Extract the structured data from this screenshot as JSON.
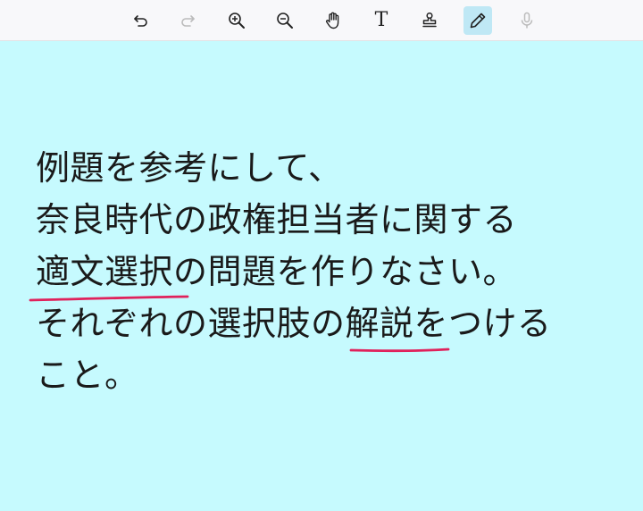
{
  "toolbar": {
    "tools": [
      {
        "name": "undo",
        "icon": "undo-icon",
        "active": false,
        "disabled": false
      },
      {
        "name": "redo",
        "icon": "redo-icon",
        "active": false,
        "disabled": true
      },
      {
        "name": "zoom-in",
        "icon": "zoom-in-icon",
        "active": false,
        "disabled": false
      },
      {
        "name": "zoom-out",
        "icon": "zoom-out-icon",
        "active": false,
        "disabled": false
      },
      {
        "name": "pan",
        "icon": "hand-icon",
        "active": false,
        "disabled": false
      },
      {
        "name": "text",
        "icon": "text-icon",
        "active": false,
        "disabled": false
      },
      {
        "name": "stamp",
        "icon": "stamp-icon",
        "active": false,
        "disabled": false
      },
      {
        "name": "pen",
        "icon": "pen-icon",
        "active": true,
        "disabled": false
      },
      {
        "name": "microphone",
        "icon": "microphone-icon",
        "active": false,
        "disabled": true
      }
    ],
    "text_tool_label": "T"
  },
  "note": {
    "lines": [
      "例題を参考にして、",
      "奈良時代の政権担当者に関する",
      "適文選択の問題を作りなさい。",
      "それぞれの選択肢の解説をつける",
      "こと。"
    ]
  },
  "colors": {
    "canvas_bg": "#c6fafe",
    "toolbar_bg": "#f8f8fa",
    "active_tool_bg": "#bfe8f5",
    "ink": "#e0215b",
    "text": "#1a1a1a",
    "icon": "#222222",
    "icon_disabled": "#bbbbbb"
  }
}
